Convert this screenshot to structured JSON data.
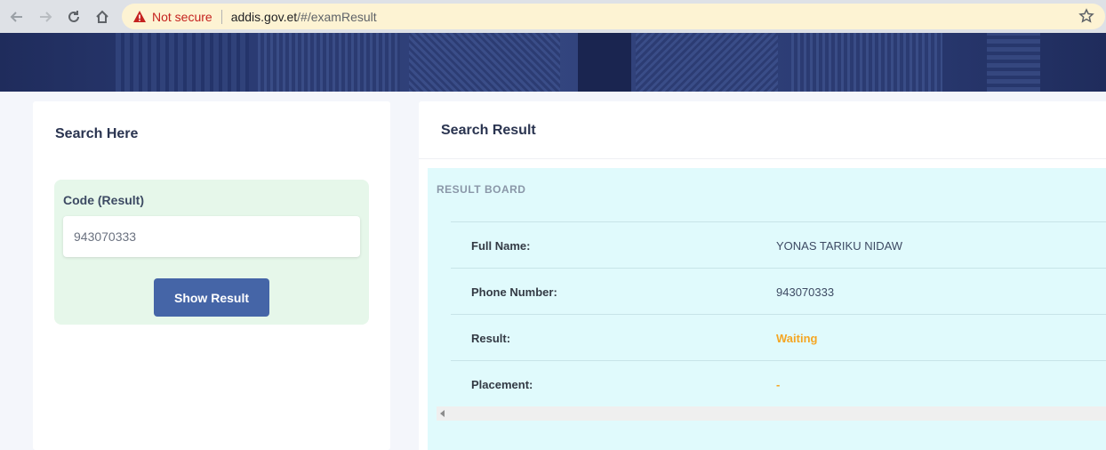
{
  "browser": {
    "security_label": "Not secure",
    "url_host": "addis.gov.et",
    "url_path": "/#/examResult",
    "icons": [
      "back-icon",
      "forward-icon",
      "reload-icon",
      "home-icon",
      "warning-icon",
      "star-icon"
    ]
  },
  "search": {
    "title": "Search Here",
    "field_label": "Code (Result)",
    "code_value": "943070333",
    "button_label": "Show Result"
  },
  "result": {
    "title": "Search Result",
    "board_title": "RESULT BOARD",
    "rows": [
      {
        "label": "Full Name:",
        "value": "YONAS TARIKU NIDAW"
      },
      {
        "label": "Phone Number:",
        "value": "943070333"
      },
      {
        "label": "Result:",
        "value": "Waiting"
      },
      {
        "label": "Placement:",
        "value": "-"
      }
    ]
  },
  "colors": {
    "primary_button": "#4565a7",
    "form_bg": "#e6f7ea",
    "board_bg": "#e0fafc",
    "status_orange": "#f5a623",
    "banner": "#2a3a72"
  }
}
